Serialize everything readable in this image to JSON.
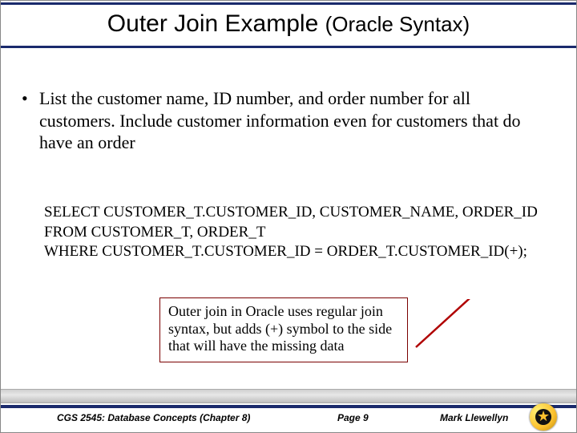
{
  "title_main": "Outer Join Example ",
  "title_sub": "(Oracle Syntax)",
  "bullet_text": "List the customer name, ID number, and order number for all customers. Include customer information even for customers that do have an order",
  "sql_line1": "SELECT CUSTOMER_T.CUSTOMER_ID, CUSTOMER_NAME, ORDER_ID",
  "sql_line2": "FROM CUSTOMER_T,  ORDER_T",
  "sql_line3": "WHERE CUSTOMER_T.CUSTOMER_ID = ORDER_T.CUSTOMER_ID(+);",
  "note_text": "Outer join in Oracle uses regular join syntax, but adds (+) symbol to the side that will have the missing data",
  "footer": {
    "course": "CGS 2545: Database Concepts  (Chapter 8)",
    "page": "Page 9",
    "author": "Mark Llewellyn"
  }
}
